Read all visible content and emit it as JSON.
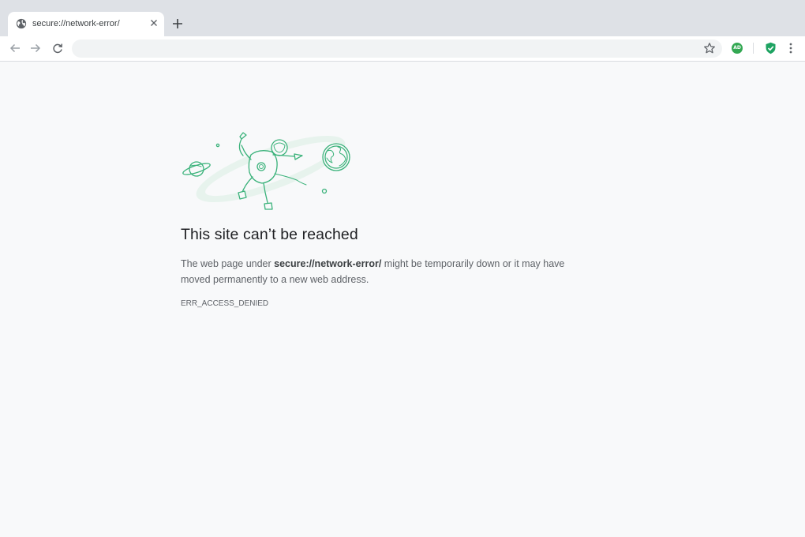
{
  "tab": {
    "title": "secure://network-error/",
    "favicon": "globe-icon",
    "close_icon": "close-icon"
  },
  "toolbar": {
    "back_icon": "arrow-left-icon",
    "forward_icon": "arrow-right-icon",
    "reload_icon": "reload-icon",
    "address": "",
    "bookmark_icon": "star-icon",
    "extension_ad_label": "AD",
    "extension_shield_icon": "shield-check-icon",
    "menu_icon": "more-vertical-icon"
  },
  "error": {
    "illustration": "astronaut-floating-in-space-illustration",
    "title": "This site can’t be reached",
    "desc_prefix": "The web page under ",
    "desc_url": "secure://network-error/",
    "desc_suffix": " might be temporarily down or it may have moved permanently to a new web address.",
    "code": "ERR_ACCESS_DENIED"
  },
  "colors": {
    "accent": "#34a853",
    "tab_strip": "#dee1e6",
    "page_bg": "#f8f9fa",
    "illustration_stroke": "#3ab27a"
  }
}
